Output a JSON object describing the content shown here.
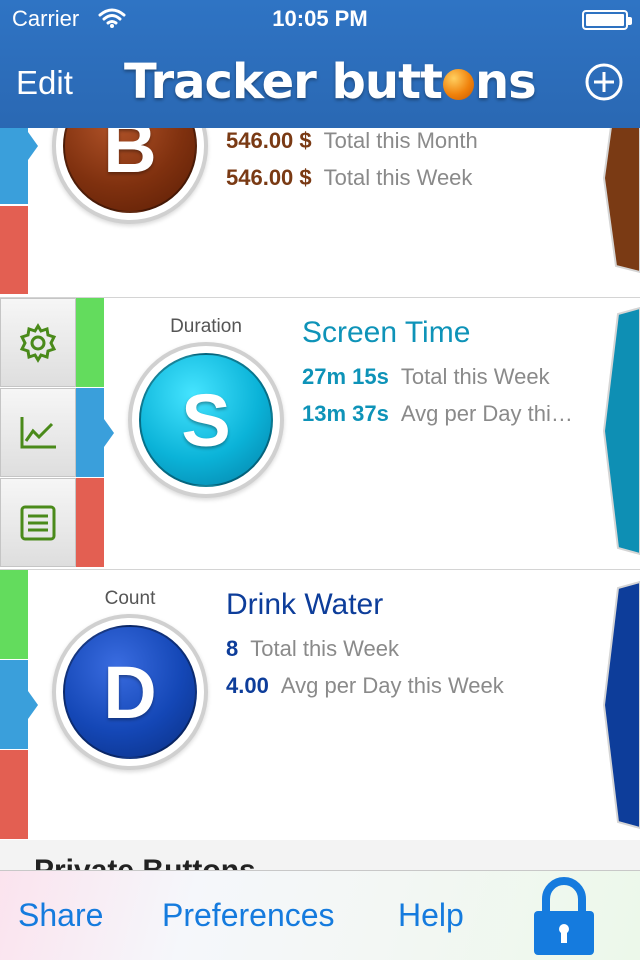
{
  "status_bar": {
    "carrier": "Carrier",
    "time": "10:05 PM"
  },
  "nav": {
    "edit_label": "Edit",
    "title_part1": "Tracker butt",
    "title_part2": "ns"
  },
  "rows": [
    {
      "letter": "B",
      "stats": [
        {
          "value": "546.00 $",
          "label": "Total this Month"
        },
        {
          "value": "546.00 $",
          "label": "Total this Week"
        }
      ],
      "color": "#7a3a14"
    },
    {
      "kind": "Duration",
      "letter": "S",
      "title": "Screen Time",
      "stats": [
        {
          "value": "27m 15s",
          "label": "Total this Week"
        },
        {
          "value": "13m 37s",
          "label": "Avg per Day thi…"
        }
      ],
      "color": "#0e93b8"
    },
    {
      "kind": "Count",
      "letter": "D",
      "title": "Drink Water",
      "stats": [
        {
          "value": "8",
          "label": "Total this Week"
        },
        {
          "value": "4.00",
          "label": "Avg per Day this Week"
        }
      ],
      "color": "#0d3d9a"
    }
  ],
  "section": {
    "title": "Private Buttons"
  },
  "toolbar": {
    "share": "Share",
    "preferences": "Preferences",
    "help": "Help"
  },
  "colors": {
    "accent": "#157bde",
    "header": "#2f74c4",
    "green_tab": "#63dc5d",
    "blue_tab": "#3a9fdb",
    "red_tab": "#e35f52"
  }
}
